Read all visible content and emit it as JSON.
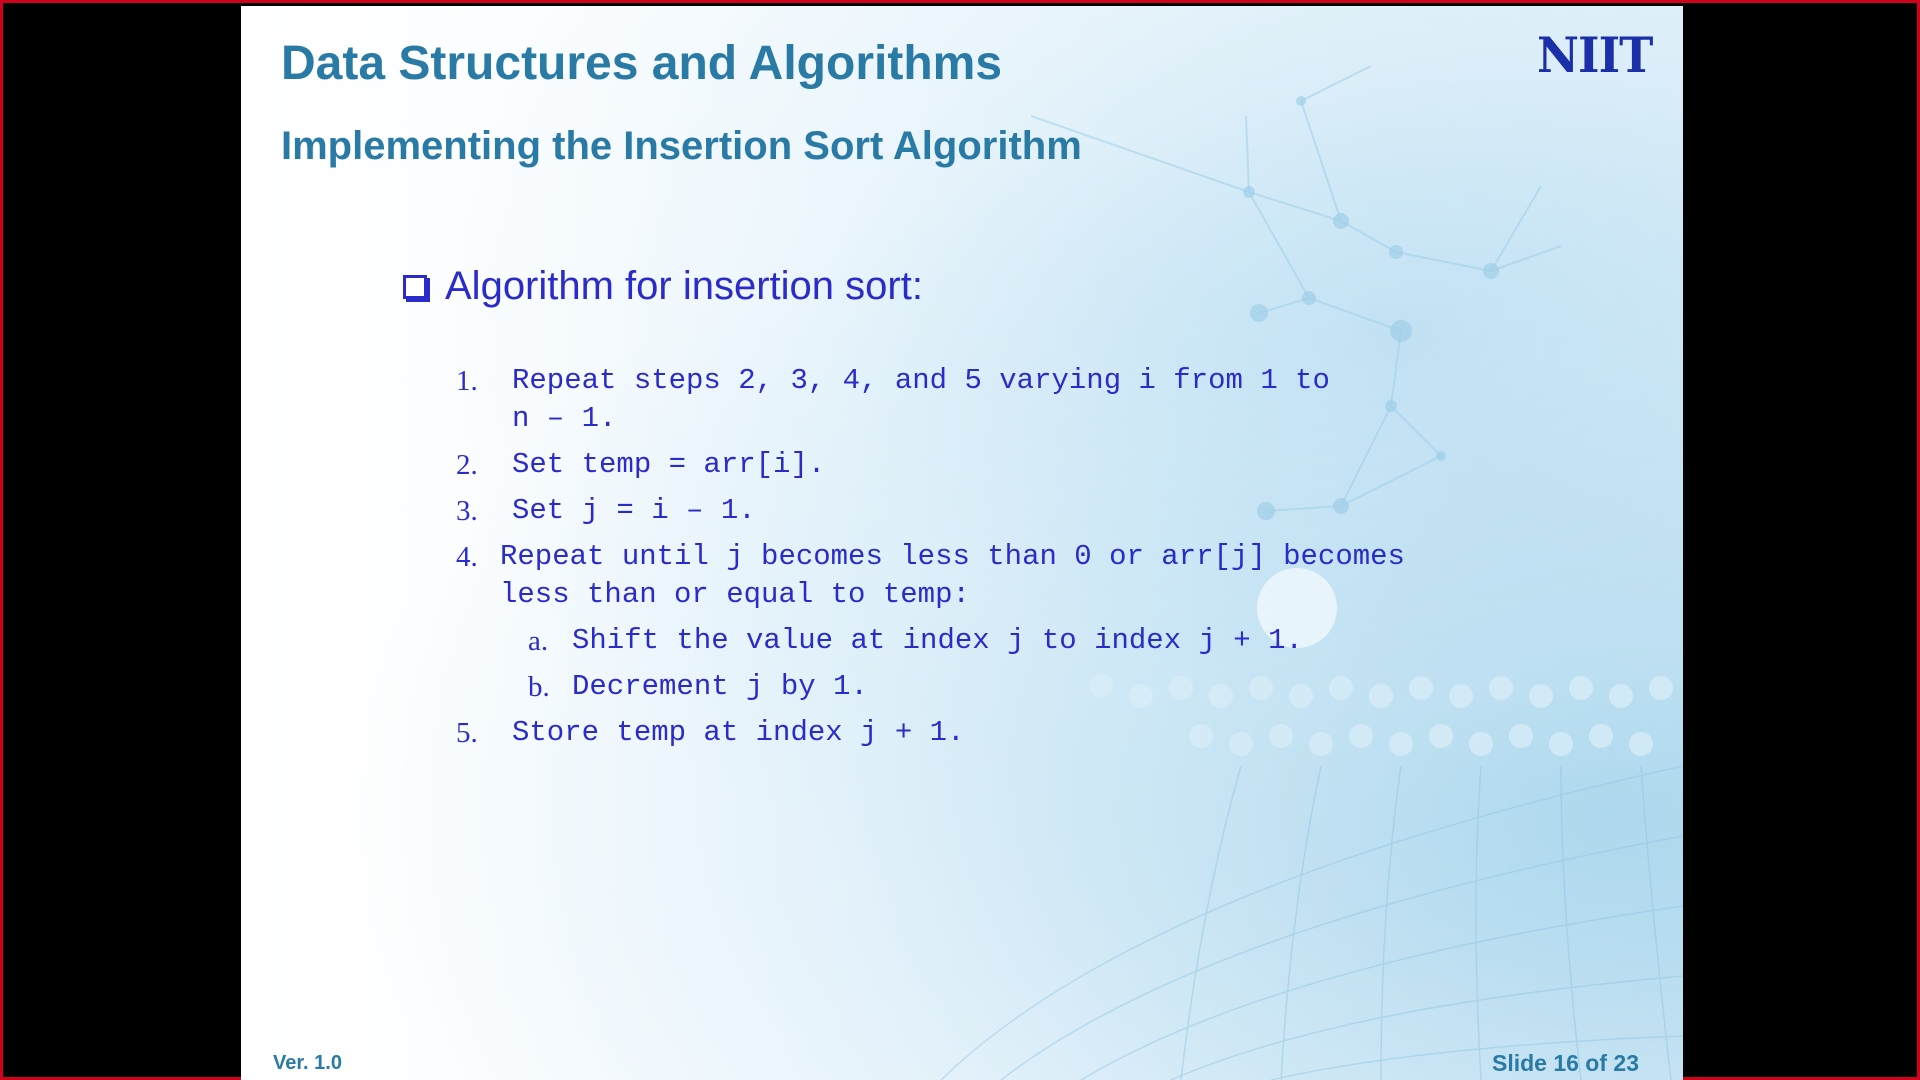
{
  "slide": {
    "title": "Data Structures and Algorithms",
    "subtitle": "Implementing the Insertion Sort Algorithm",
    "logo_text": "NIIT",
    "bullet": {
      "icon": "checkbox-square-icon",
      "text": "Algorithm for insertion sort:"
    },
    "steps": [
      {
        "num": "1.",
        "text": "Repeat steps 2, 3, 4, and 5 varying i from 1 to\nn – 1."
      },
      {
        "num": "2.",
        "text": "Set temp = arr[i]."
      },
      {
        "num": "3.",
        "text": "Set j = i – 1."
      },
      {
        "num": "4.",
        "text": "Repeat until j becomes less than 0 or arr[j] becomes\nless than or equal to temp:"
      }
    ],
    "substeps": [
      {
        "num": "a.",
        "text": "Shift the value at index j to index j + 1."
      },
      {
        "num": "b.",
        "text": "Decrement j by 1."
      }
    ],
    "final_step": {
      "num": "5.",
      "text": "Store temp at index j + 1."
    },
    "footer": {
      "version": "Ver. 1.0",
      "slide_counter": "Slide 16 of 23"
    }
  },
  "colors": {
    "frame_border": "#d0021b",
    "title": "#2a7aa6",
    "body_text": "#2b2bc9",
    "logo": "#1a2fa8"
  }
}
